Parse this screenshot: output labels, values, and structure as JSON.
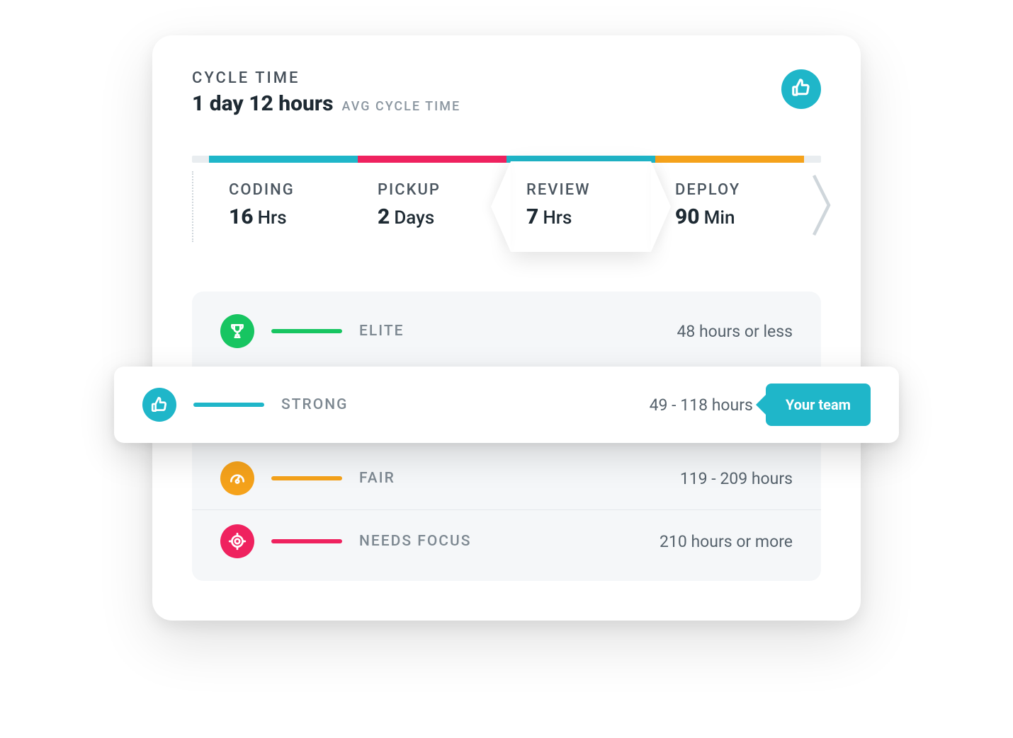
{
  "header": {
    "title": "CYCLE TIME",
    "value": "1 day 12 hours",
    "sublabel": "AVG CYCLE TIME"
  },
  "stages": [
    {
      "key": "coding",
      "label": "CODING",
      "value": "16",
      "unit": "Hrs",
      "color": "#1fb6c9"
    },
    {
      "key": "pickup",
      "label": "PICKUP",
      "value": "2",
      "unit": "Days",
      "color": "#ef225f"
    },
    {
      "key": "review",
      "label": "REVIEW",
      "value": "7",
      "unit": "Hrs",
      "color": "#1fb6c9",
      "highlighted": true
    },
    {
      "key": "deploy",
      "label": "DEPLOY",
      "value": "90",
      "unit": "Min",
      "color": "#f5a21b"
    }
  ],
  "benchmarks": {
    "your_team_label": "Your team",
    "tiers": [
      {
        "key": "elite",
        "label": "ELITE",
        "range": "48 hours or less",
        "color": "#17c561",
        "icon": "trophy"
      },
      {
        "key": "strong",
        "label": "STRONG",
        "range": "49 - 118 hours",
        "color": "#1fb6c9",
        "icon": "thumbs-up",
        "active": true
      },
      {
        "key": "fair",
        "label": "FAIR",
        "range": "119 - 209 hours",
        "color": "#f5a21b",
        "icon": "gauge"
      },
      {
        "key": "focus",
        "label": "NEEDS FOCUS",
        "range": "210 hours or more",
        "color": "#ef225f",
        "icon": "target"
      }
    ]
  },
  "colors": {
    "teal": "#1fb6c9",
    "pink": "#ef225f",
    "orange": "#f5a21b",
    "green": "#17c561"
  }
}
